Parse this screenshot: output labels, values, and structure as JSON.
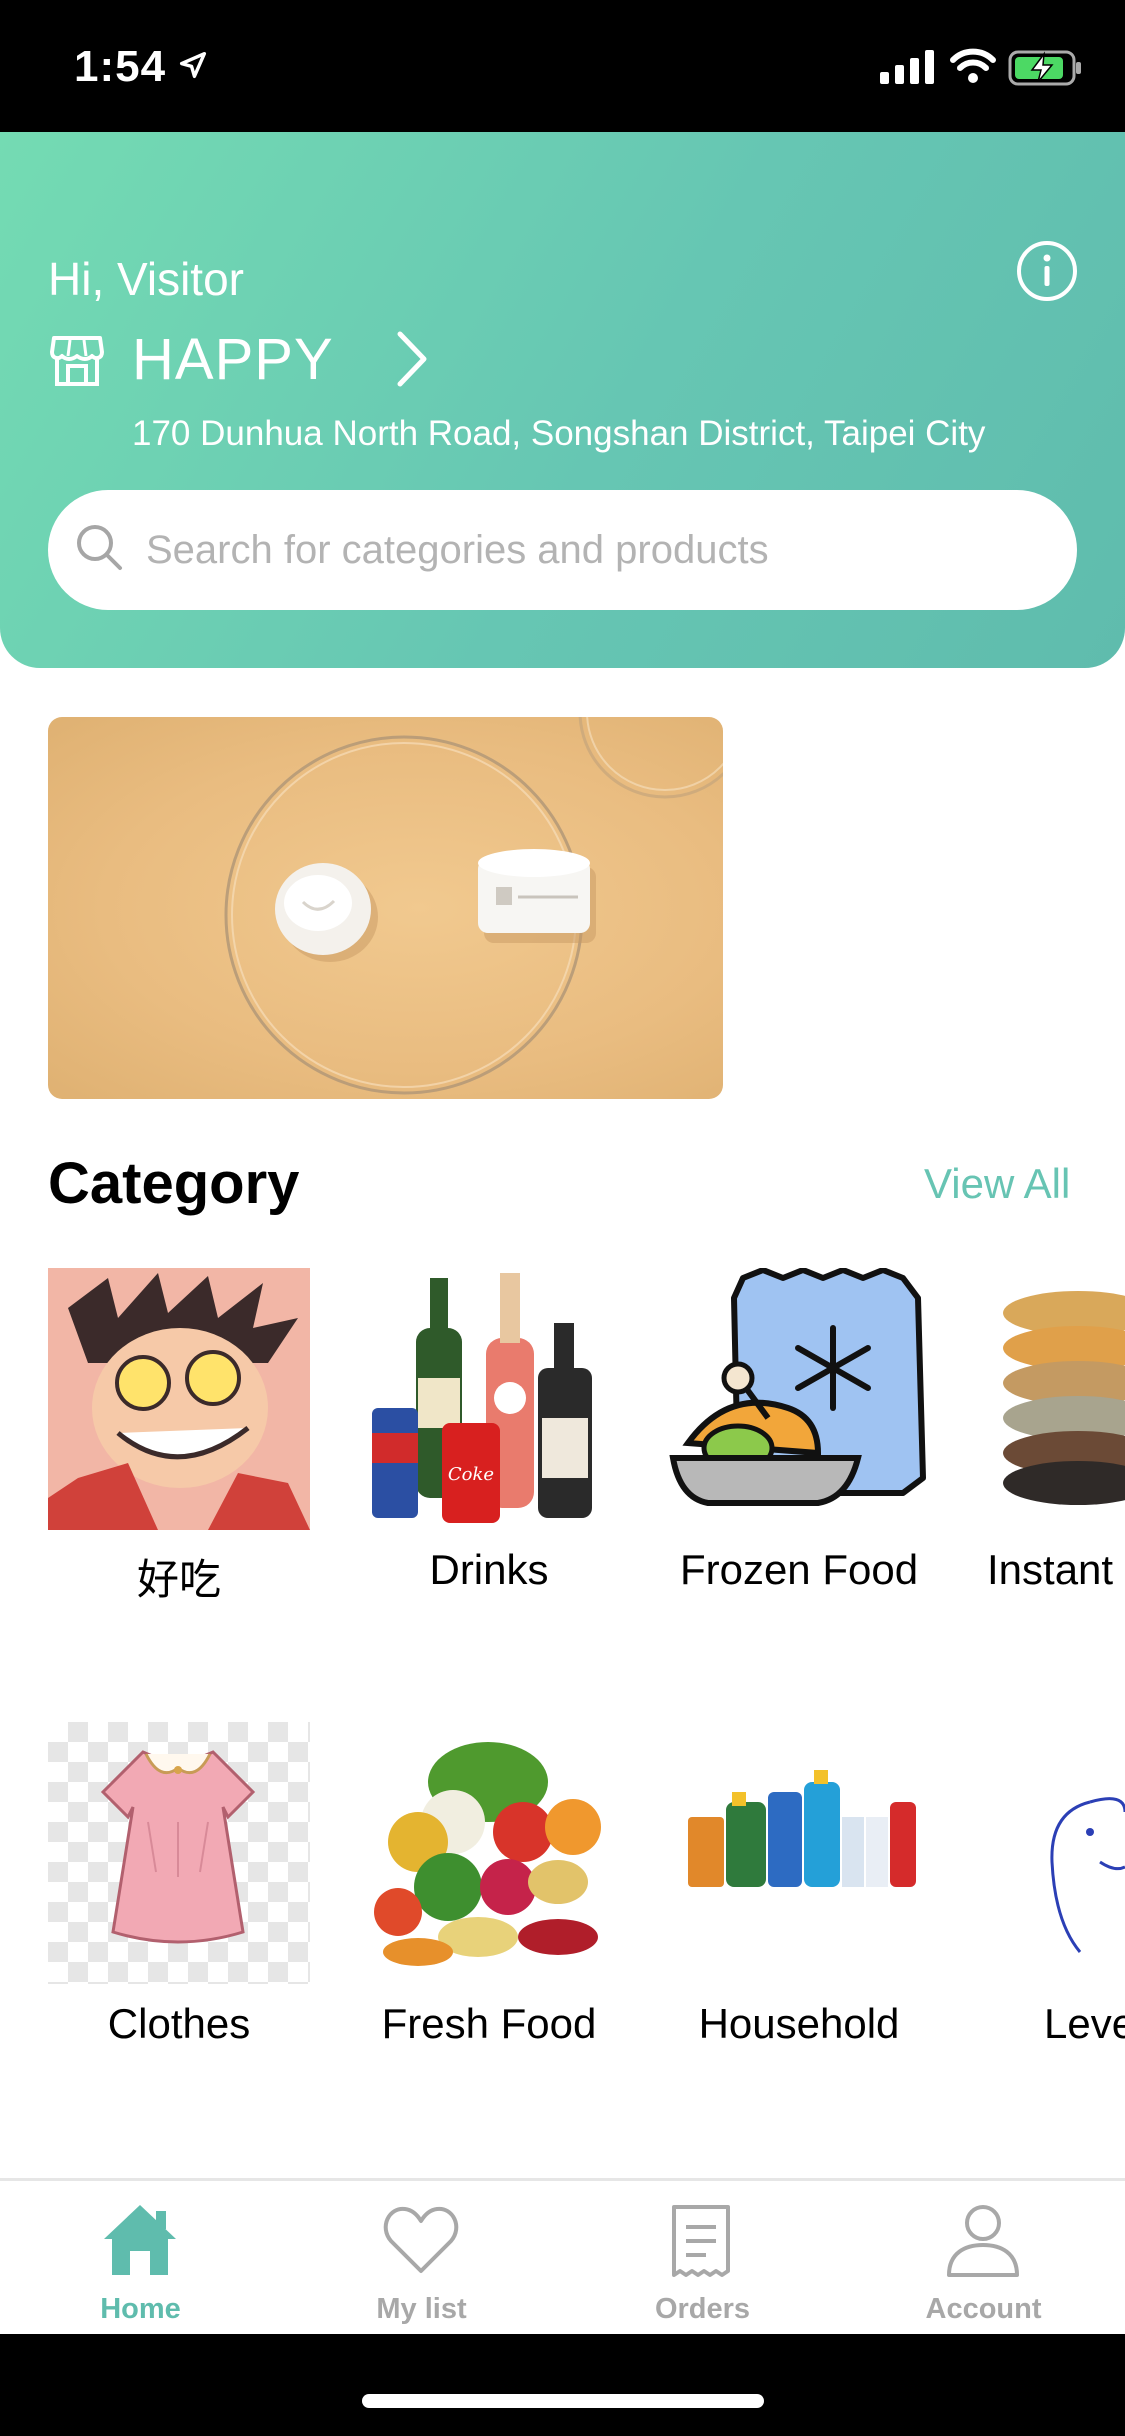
{
  "status_bar": {
    "time": "1:54"
  },
  "header": {
    "greeting": "Hi, Visitor",
    "store_name": "HAPPY",
    "address": "170 Dunhua North Road, Songshan District, Taipei City"
  },
  "search": {
    "placeholder": "Search for categories and products"
  },
  "category": {
    "title": "Category",
    "view_all": "View All",
    "items": [
      {
        "label": "好吃",
        "icon": "cartoon-character"
      },
      {
        "label": "Drinks",
        "icon": "bottles"
      },
      {
        "label": "Frozen Food",
        "icon": "frozen-food"
      },
      {
        "label": "Instant",
        "icon": "instant-noodles"
      },
      {
        "label": "Clothes",
        "icon": "pink-dress"
      },
      {
        "label": "Fresh Food",
        "icon": "vegetables"
      },
      {
        "label": "Household",
        "icon": "cleaning-products"
      },
      {
        "label": "Leve",
        "icon": "sketch"
      }
    ]
  },
  "tabs": [
    {
      "label": "Home",
      "icon": "home-icon",
      "active": true
    },
    {
      "label": "My list",
      "icon": "heart-icon",
      "active": false
    },
    {
      "label": "Orders",
      "icon": "receipt-icon",
      "active": false
    },
    {
      "label": "Account",
      "icon": "user-icon",
      "active": false
    }
  ],
  "colors": {
    "accent": "#5fbcad",
    "header_start": "#74dbb3",
    "header_end": "#5fbcad"
  }
}
